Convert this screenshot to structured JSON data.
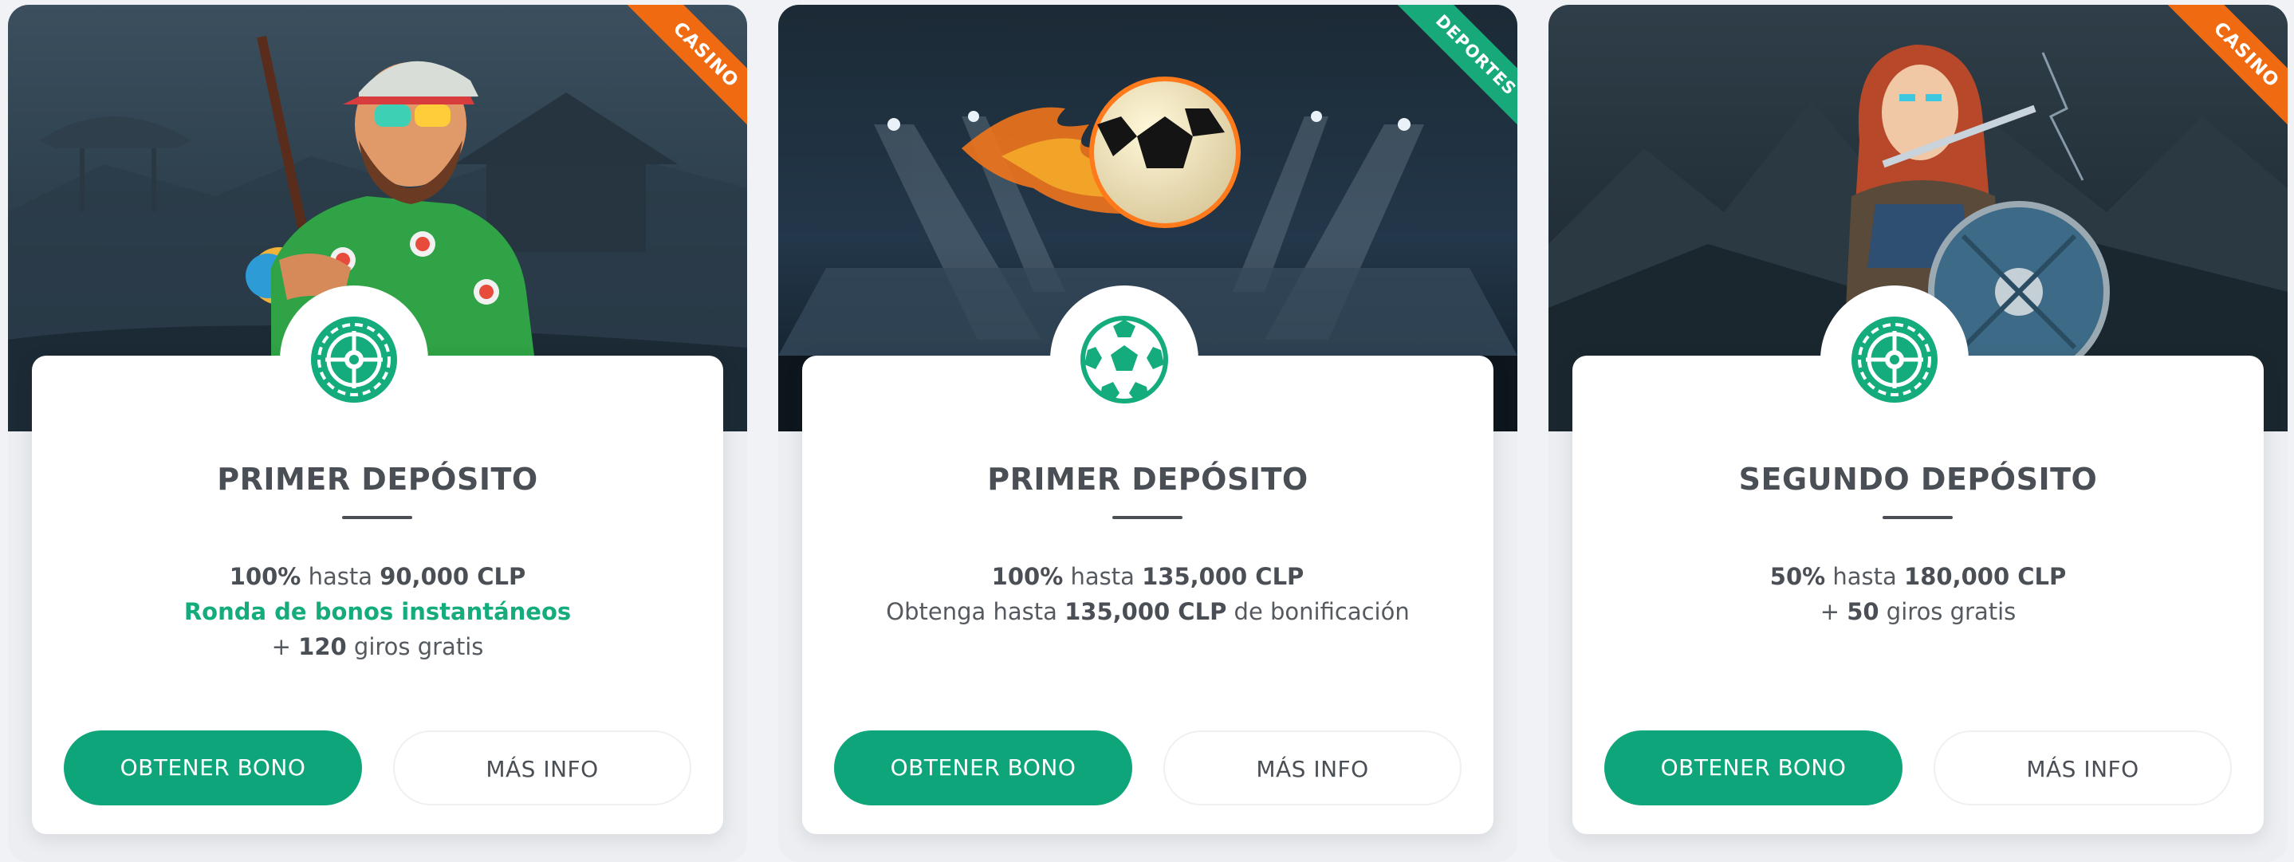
{
  "colors": {
    "primary_green": "#0ea57a",
    "text_green": "#14ab7d",
    "casino_ribbon": "#f06a12",
    "sports_ribbon": "#17a97a"
  },
  "cards": [
    {
      "ribbon": "CASINO",
      "icon": "roulette-icon",
      "title": "PRIMER DEPÓSITO",
      "line1": {
        "pct": "100%",
        "mid": " hasta ",
        "amount": "90,000 CLP"
      },
      "line2_green": "Ronda de bonos instantáneos",
      "line3": {
        "pre": "+ ",
        "num": "120",
        "post": " giros gratis"
      },
      "cta": "OBTENER BONO",
      "info": "MÁS INFO"
    },
    {
      "ribbon": "DEPORTES",
      "icon": "soccer-ball-icon",
      "title": "PRIMER DEPÓSITO",
      "line1": {
        "pct": "100%",
        "mid": " hasta ",
        "amount": "135,000 CLP"
      },
      "line2": {
        "pre": "Obtenga hasta ",
        "amount": "135,000 CLP",
        "post": " de bonificación"
      },
      "cta": "OBTENER BONO",
      "info": "MÁS INFO"
    },
    {
      "ribbon": "CASINO",
      "icon": "roulette-icon",
      "title": "SEGUNDO DEPÓSITO",
      "line1": {
        "pct": "50%",
        "mid": " hasta ",
        "amount": "180,000 CLP"
      },
      "line2": {
        "pre": "+ ",
        "num": "50",
        "post": " giros gratis"
      },
      "cta": "OBTENER BONO",
      "info": "MÁS INFO"
    }
  ]
}
